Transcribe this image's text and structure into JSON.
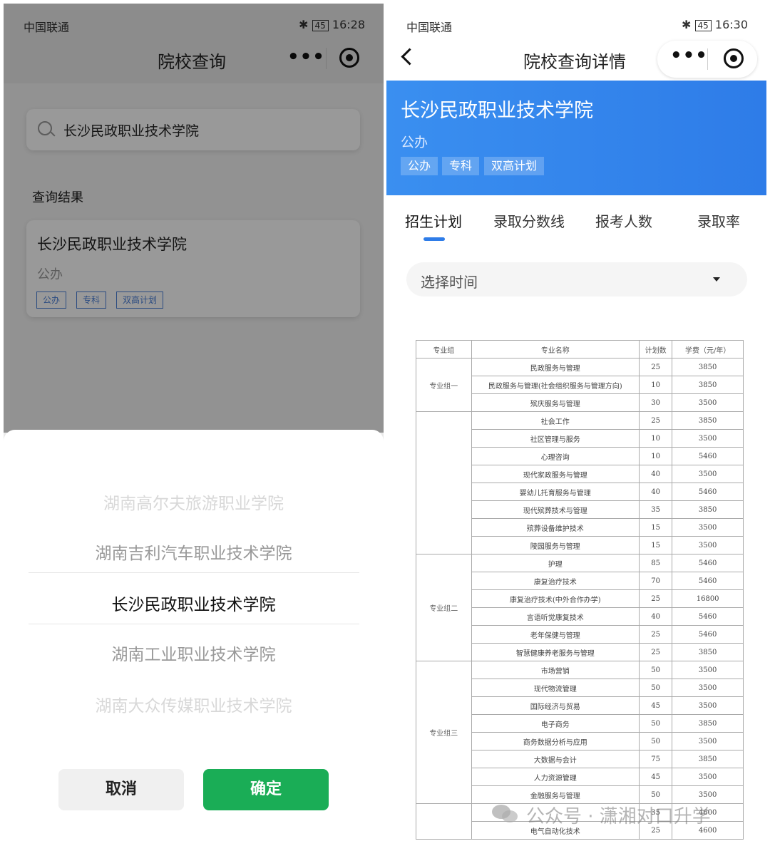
{
  "left": {
    "status": {
      "carrier": "中国联通",
      "time": "16:28",
      "battery": "45"
    },
    "nav_title": "院校查询",
    "search": {
      "value": "长沙民政职业技术学院"
    },
    "result_label": "查询结果",
    "result_card": {
      "name": "长沙民政职业技术学院",
      "type": "公办",
      "tags": [
        "公办",
        "专科",
        "双高计划"
      ]
    },
    "picker": {
      "items": [
        "湖南高尔夫旅游职业学院",
        "湖南吉利汽车职业技术学院",
        "长沙民政职业技术学院",
        "湖南工业职业技术学院",
        "湖南大众传媒职业技术学院"
      ],
      "cancel": "取消",
      "confirm": "确定"
    }
  },
  "right": {
    "status": {
      "carrier": "中国联通",
      "time": "16:30",
      "battery": "45"
    },
    "nav_title": "院校查询详情",
    "banner": {
      "name": "长沙民政职业技术学院",
      "type": "公办",
      "tags": [
        "公办",
        "专科",
        "双高计划"
      ]
    },
    "tabs": [
      "招生计划",
      "录取分数线",
      "报考人数",
      "录取率"
    ],
    "time_select": "选择时间",
    "table": {
      "headers": [
        "专业组",
        "专业名称",
        "计划数",
        "学费（元/年）"
      ],
      "groups": [
        {
          "name": "专业组一",
          "rows": [
            [
              "民政服务与管理",
              "25",
              "3850"
            ],
            [
              "民政服务与管理(社会组织服务与管理方向)",
              "10",
              "3850"
            ],
            [
              "殡庆服务与管理",
              "30",
              "3500"
            ]
          ]
        },
        {
          "name": "",
          "rows": [
            [
              "社会工作",
              "25",
              "3850"
            ],
            [
              "社区管理与服务",
              "10",
              "3500"
            ],
            [
              "心理咨询",
              "10",
              "5460"
            ],
            [
              "现代家政服务与管理",
              "40",
              "3500"
            ],
            [
              "婴幼儿托育服务与管理",
              "40",
              "5460"
            ],
            [
              "现代殡葬技术与管理",
              "35",
              "3850"
            ],
            [
              "殡葬设备维护技术",
              "15",
              "3500"
            ],
            [
              "陵园服务与管理",
              "15",
              "3500"
            ]
          ]
        },
        {
          "name": "专业组二",
          "rows": [
            [
              "护理",
              "85",
              "5460"
            ],
            [
              "康复治疗技术",
              "70",
              "5460"
            ],
            [
              "康复治疗技术(中外合作办学)",
              "25",
              "16800"
            ],
            [
              "言语听觉康复技术",
              "40",
              "5460"
            ],
            [
              "老年保健与管理",
              "25",
              "5460"
            ],
            [
              "智慧健康养老服务与管理",
              "25",
              "3850"
            ]
          ]
        },
        {
          "name": "专业组三",
          "rows": [
            [
              "市场营销",
              "50",
              "3500"
            ],
            [
              "现代物流管理",
              "50",
              "3500"
            ],
            [
              "国际经济与贸易",
              "45",
              "3500"
            ],
            [
              "电子商务",
              "50",
              "3850"
            ],
            [
              "商务数据分析与应用",
              "50",
              "3500"
            ],
            [
              "大数据与会计",
              "75",
              "3850"
            ],
            [
              "人力资源管理",
              "45",
              "3500"
            ],
            [
              "金融服务与管理",
              "50",
              "3500"
            ]
          ]
        },
        {
          "name": "",
          "rows": [
            [
              "",
              "35",
              "4600"
            ],
            [
              "电气自动化技术",
              "25",
              "4600"
            ]
          ]
        }
      ]
    },
    "watermark": "公众号 · 潇湘对口升学"
  }
}
